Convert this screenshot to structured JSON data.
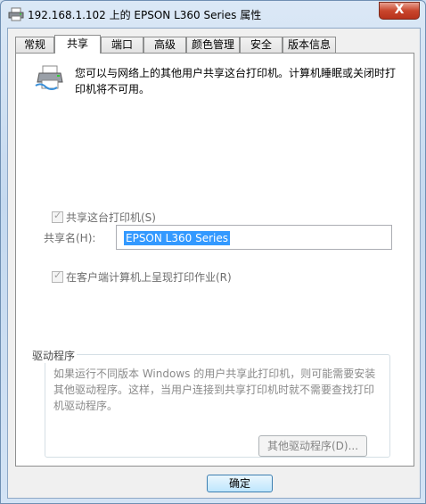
{
  "window": {
    "title": "192.168.1.102 上的 EPSON L360 Series 属性",
    "close_label": "X"
  },
  "tabs": [
    {
      "label": "常规"
    },
    {
      "label": "共享",
      "active": true
    },
    {
      "label": "端口"
    },
    {
      "label": "高级"
    },
    {
      "label": "颜色管理"
    },
    {
      "label": "安全"
    },
    {
      "label": "版本信息"
    }
  ],
  "sharing": {
    "intro_text": "您可以与网络上的其他用户共享这台打印机。计算机睡眠或关闭时打印机将不可用。",
    "share_checkbox_label": "共享这台打印机(S)",
    "share_checked": true,
    "share_name_label": "共享名(H):",
    "share_name_value": "EPSON L360 Series",
    "render_jobs_label": "在客户端计算机上呈现打印作业(R)",
    "render_jobs_checked": true
  },
  "drivers": {
    "group_title": "驱动程序",
    "description": "如果运行不同版本 Windows 的用户共享此打印机，则可能需要安装其他驱动程序。这样，当用户连接到共享打印机时就不需要查找打印机驱动程序。",
    "additional_drivers_button": "其他驱动程序(D)..."
  },
  "footer": {
    "ok_button": "确定"
  }
}
